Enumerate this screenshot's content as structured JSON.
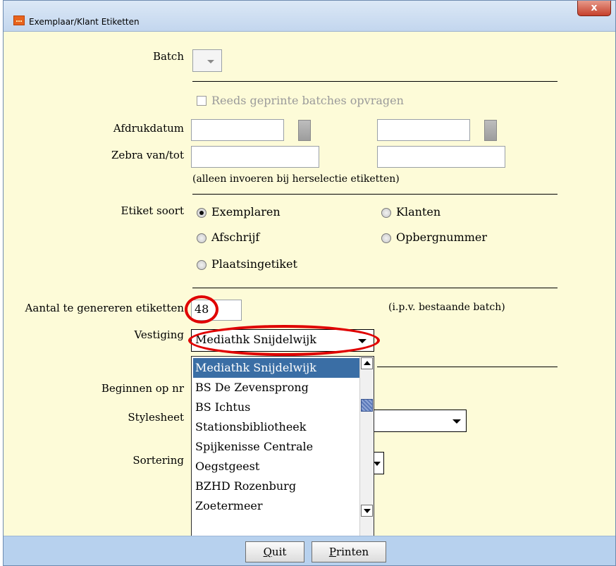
{
  "window": {
    "title": "Exemplaar/Klant Etiketten",
    "close_label": "x"
  },
  "form": {
    "batch_label": "Batch",
    "reprint_checkbox_label": "Reeds geprinte batches opvragen",
    "print_date_label": "Afdrukdatum",
    "zebra_label": "Zebra van/tot",
    "reselect_note": "(alleen invoeren bij herselectie etiketten)",
    "label_type_label": "Etiket soort",
    "label_types": [
      {
        "label": "Exemplaren",
        "selected": true
      },
      {
        "label": "Klanten",
        "selected": false
      },
      {
        "label": "Afschrijf",
        "selected": false
      },
      {
        "label": "Opbergnummer",
        "selected": false
      },
      {
        "label": "Plaatsingetiket",
        "selected": false
      }
    ],
    "count_label": "Aantal te genereren etiketten",
    "count_value": "48",
    "count_note": "(i.p.v. bestaande batch)",
    "branch_label": "Vestiging",
    "branch_value": "Mediathk Snijdelwijk",
    "start_nr_label": "Beginnen op nr",
    "stylesheet_label": "Stylesheet",
    "sort_label": "Sortering"
  },
  "branch_dropdown": {
    "options": [
      "Mediathk Snijdelwijk",
      "BS De Zevensprong",
      "BS Ichtus",
      "Stationsbibliotheek",
      "Spijkenisse Centrale",
      "Oegstgeest",
      "BZHD Rozenburg",
      "Zoetermeer"
    ],
    "selected_index": 0
  },
  "footer": {
    "quit_first": "Q",
    "quit_rest": "uit",
    "print_first": "P",
    "print_rest": "rinten"
  },
  "colors": {
    "form_background": "#fdfbd8",
    "footer_background": "#b7d1ee",
    "selection": "#3a6ea5",
    "annotation": "#e00000"
  }
}
